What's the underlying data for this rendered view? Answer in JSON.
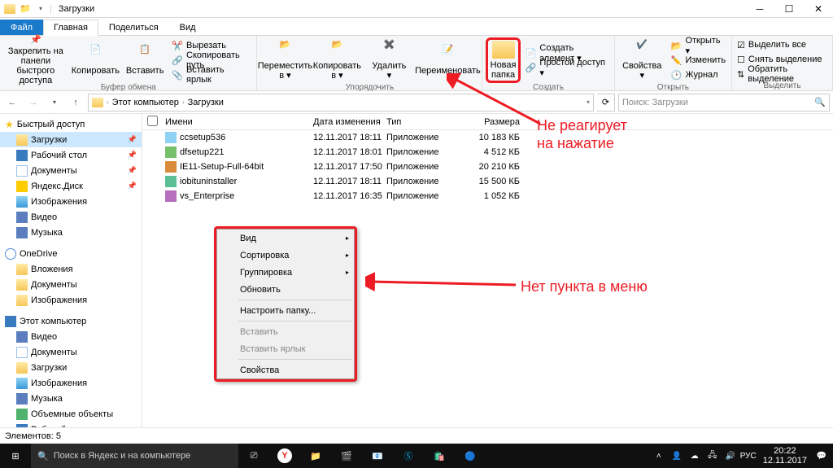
{
  "window": {
    "title": "Загрузки"
  },
  "ribbon_tabs": {
    "file": "Файл",
    "home": "Главная",
    "share": "Поделиться",
    "view": "Вид"
  },
  "ribbon": {
    "pin": "Закрепить на панели\nбыстрого доступа",
    "copy": "Копировать",
    "paste": "Вставить",
    "cut": "Вырезать",
    "copypath": "Скопировать путь",
    "paste_shortcut": "Вставить ярлык",
    "clipboard_label": "Буфер обмена",
    "moveto": "Переместить\nв ▾",
    "copyto": "Копировать\nв ▾",
    "delete": "Удалить\n▾",
    "rename": "Переименовать",
    "organize_label": "Упорядочить",
    "newfolder": "Новая\nпапка",
    "newitem": "Создать элемент ▾",
    "easyaccess": "Простой доступ ▾",
    "create_label": "Создать",
    "properties": "Свойства\n▾",
    "open": "Открыть ▾",
    "edit": "Изменить",
    "history": "Журнал",
    "open_label": "Открыть",
    "selectall": "Выделить все",
    "selectnone": "Снять выделение",
    "invert": "Обратить выделение",
    "select_label": "Выделить"
  },
  "breadcrumbs": [
    "Этот компьютер",
    "Загрузки"
  ],
  "search_placeholder": "Поиск: Загрузки",
  "sidebar": {
    "quick": {
      "title": "Быстрый доступ",
      "items": [
        "Загрузки",
        "Рабочий стол",
        "Документы",
        "Яндекс.Диск",
        "Изображения",
        "Видео",
        "Музыка"
      ]
    },
    "onedrive": {
      "title": "OneDrive",
      "items": [
        "Вложения",
        "Документы",
        "Изображения"
      ]
    },
    "pc": {
      "title": "Этот компьютер",
      "items": [
        "Видео",
        "Документы",
        "Загрузки",
        "Изображения",
        "Музыка",
        "Объемные объекты",
        "Рабочий стол"
      ]
    }
  },
  "columns": {
    "name": "Имени",
    "date": "Дата изменения",
    "type": "Тип",
    "size": "Размера"
  },
  "files": [
    {
      "name": "ccsetup536",
      "date": "12.11.2017 18:11",
      "type": "Приложение",
      "size": "10 183 КБ"
    },
    {
      "name": "dfsetup221",
      "date": "12.11.2017 18:01",
      "type": "Приложение",
      "size": "4 512 КБ"
    },
    {
      "name": "IE11-Setup-Full-64bit",
      "date": "12.11.2017 17:50",
      "type": "Приложение",
      "size": "20 210 КБ"
    },
    {
      "name": "iobituninstaller",
      "date": "12.11.2017 18:11",
      "type": "Приложение",
      "size": "15 500 КБ"
    },
    {
      "name": "vs_Enterprise",
      "date": "12.11.2017 16:35",
      "type": "Приложение",
      "size": "1 052 КБ"
    }
  ],
  "context_menu": {
    "view": "Вид",
    "sort": "Сортировка",
    "group": "Группировка",
    "refresh": "Обновить",
    "customize": "Настроить папку...",
    "paste": "Вставить",
    "paste_shortcut": "Вставить ярлык",
    "properties": "Свойства"
  },
  "status": "Элементов: 5",
  "annotation1": "Не реагирует\nна нажатие",
  "annotation2": "Нет пункта в меню",
  "taskbar": {
    "search_placeholder": "Поиск в Яндекс и на компьютере",
    "time": "20:22",
    "date": "12.11.2017",
    "lang": "РУС"
  }
}
